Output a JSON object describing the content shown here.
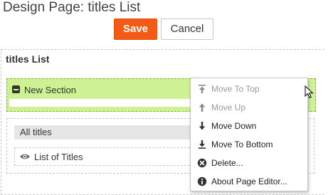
{
  "header": {
    "title": "Design Page: titles List"
  },
  "toolbar": {
    "save_label": "Save",
    "cancel_label": "Cancel"
  },
  "zone": {
    "title": "titles List"
  },
  "section": {
    "label": "New Section"
  },
  "block": {
    "header": "All titles",
    "item_label": "List of Titles"
  },
  "context_menu": {
    "items": [
      {
        "label": "Move To Top",
        "icon": "arrow-top-icon",
        "disabled": true
      },
      {
        "label": "Move Up",
        "icon": "arrow-up-icon",
        "disabled": true
      },
      {
        "label": "Move Down",
        "icon": "arrow-down-icon",
        "disabled": false
      },
      {
        "label": "Move To Bottom",
        "icon": "arrow-bottom-icon",
        "disabled": false
      },
      {
        "label": "Delete...",
        "icon": "delete-icon",
        "disabled": false
      },
      {
        "label": "About Page Editor...",
        "icon": "info-icon",
        "disabled": false
      }
    ]
  },
  "colors": {
    "save": "#f25a16",
    "section_fill": "#cef293",
    "section_border": "#7fb32b",
    "disabled_text": "#9a9a9a"
  }
}
